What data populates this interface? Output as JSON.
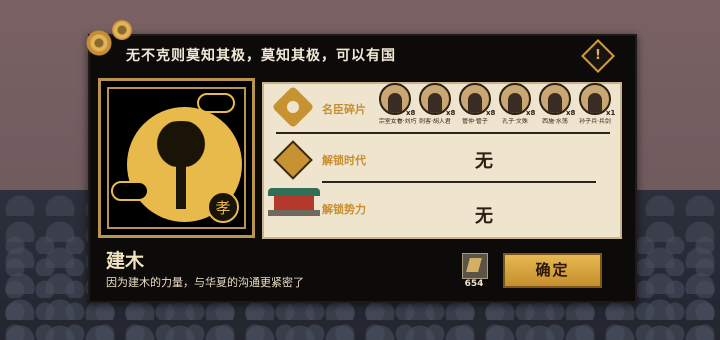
{
  "dialog": {
    "quote": "无不克则莫知其极，莫知其极，可以有国",
    "info_icon": "!",
    "seal_char": "孝",
    "title": "建木",
    "description": "因为建木的力量，与华夏的沟通更紧密了",
    "confirm_label": "确定"
  },
  "unlocks": {
    "fragments_label": "名臣碎片",
    "era_label": "解锁时代",
    "era_value": "无",
    "faction_label": "解锁势力",
    "faction_value": "无"
  },
  "fragments": [
    {
      "name": "宗室女眷·刘巧",
      "count": "x8"
    },
    {
      "name": "刺客·胡人君",
      "count": "x8"
    },
    {
      "name": "管仲·管子",
      "count": "x8"
    },
    {
      "name": "孔子·文殊",
      "count": "x8"
    },
    {
      "name": "西施·水荡",
      "count": "x8"
    },
    {
      "name": "孙子兵·兵剑",
      "count": "x1"
    }
  ],
  "resource": {
    "icon": "scroll-icon",
    "count": "654"
  },
  "colors": {
    "gold": "#e8b94b",
    "panel": "#efe4cd",
    "label": "#c78f32",
    "dialog_bg": "#0d0b0a"
  }
}
